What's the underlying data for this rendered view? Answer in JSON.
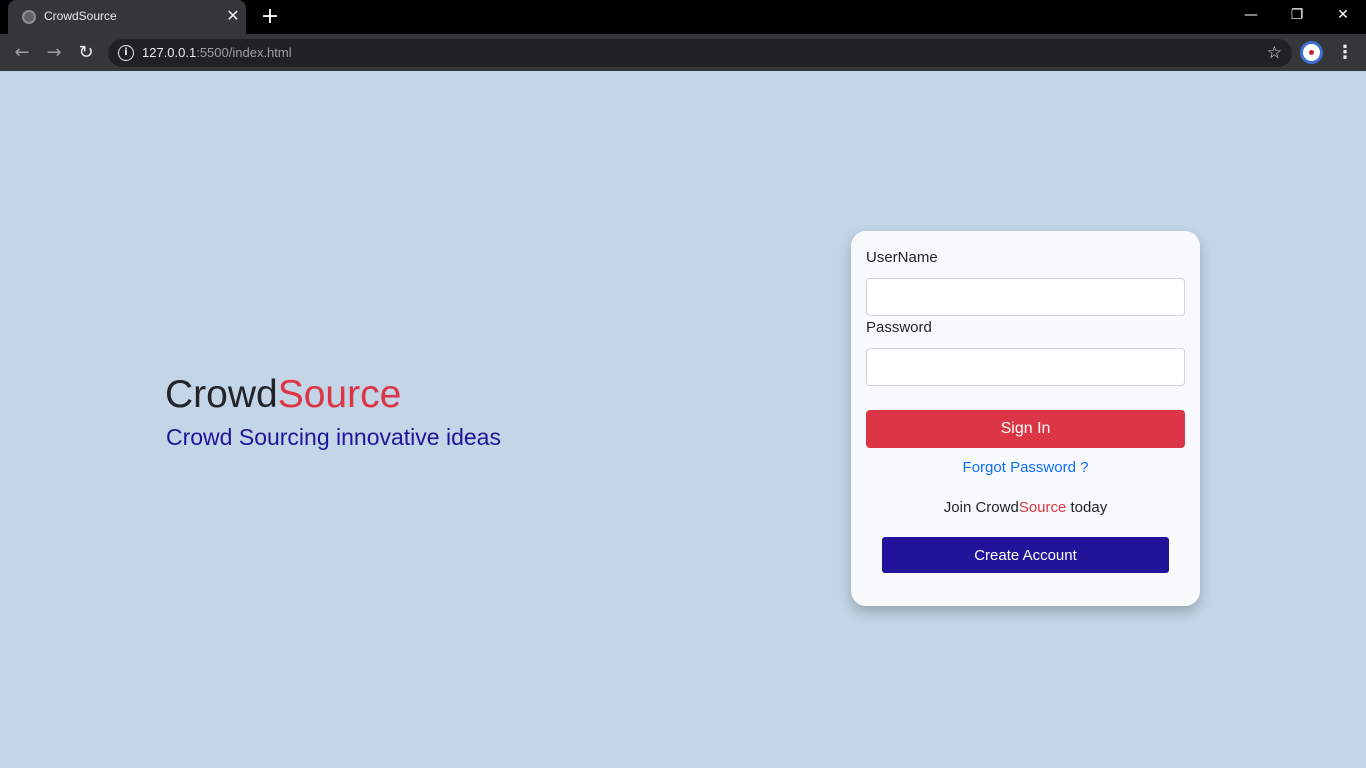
{
  "browser": {
    "tab_title": "CrowdSource",
    "tab_close": "✕",
    "new_tab": "+",
    "url_host": "127.0.0.1",
    "url_path": ":5500/index.html",
    "window_minimize": "—",
    "window_restore": "❐",
    "window_close": "✕",
    "nav_back": "←",
    "nav_forward": "→",
    "reload": "↻",
    "bookmark": "☆",
    "menu": "⋮",
    "info": "i"
  },
  "hero": {
    "brand_part1": "Crowd",
    "brand_part2": "Source",
    "tagline": "Crowd Sourcing innovative ideas"
  },
  "login": {
    "username_label": "UserName",
    "username_value": "",
    "password_label": "Password",
    "password_value": "",
    "signin_label": "Sign In",
    "forgot_label": "Forgot Password ?",
    "join_prefix": "Join Crowd",
    "join_brand": "Source",
    "join_suffix": " today",
    "create_label": "Create Account"
  },
  "colors": {
    "page_bg": "#c3d5e6",
    "accent_red": "#dc3545",
    "accent_indigo": "#22149a",
    "link_blue": "#0d6efd"
  }
}
